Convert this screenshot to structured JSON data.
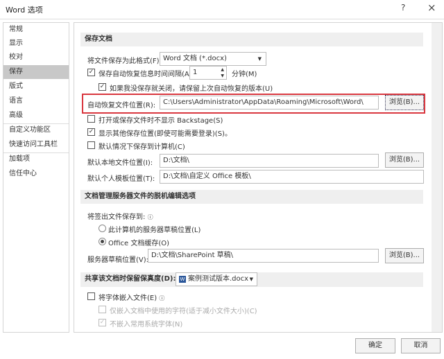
{
  "window": {
    "title": "Word 选项",
    "help": "?",
    "close": "×"
  },
  "sidebar": {
    "items": [
      "常规",
      "显示",
      "校对",
      "保存",
      "版式",
      "语言",
      "高级",
      "自定义功能区",
      "快速访问工具栏",
      "加载项",
      "信任中心"
    ],
    "selected": "保存"
  },
  "save": {
    "section_title": "保存文档",
    "format_label": "将文件保存为此格式(F):",
    "format_value": "Word 文档 (*.docx)",
    "autosave_label": "保存自动恢复信息时间间隔(A)",
    "autosave_checked": true,
    "autosave_value": "1",
    "minutes_label": "分钟(M)",
    "keep_last_label": "如果我没保存就关闭，请保留上次自动恢复的版本(U)",
    "keep_last_checked": true,
    "autorecover_label": "自动恢复文件位置(R):",
    "autorecover_value": "C:\\Users\\Administrator\\AppData\\Roaming\\Microsoft\\Word\\",
    "browse": "浏览(B)...",
    "no_backstage_label": "打开或保存文件时不显示 Backstage(S)",
    "no_backstage_checked": false,
    "show_other_label": "显示其他保存位置(即使可能需要登录)(S)。",
    "show_other_checked": true,
    "save_computer_label": "默认情况下保存到计算机(C)",
    "save_computer_checked": false,
    "local_label": "默认本地文件位置(I):",
    "local_value": "D:\\文档\\",
    "template_label": "默认个人模板位置(T):",
    "template_value": "D:\\文档\\自定义 Office 模板\\"
  },
  "offline": {
    "section_title": "文档管理服务器文件的脱机编辑选项",
    "checkout_label": "将签出文件保存到:",
    "radio1": "此计算机的服务器草稿位置(L)",
    "radio2": "Office 文档缓存(O)",
    "selected": "Office 文档缓存(O)",
    "drafts_label": "服务器草稿位置(V):",
    "drafts_value": "D:\\文档\\SharePoint 草稿\\"
  },
  "fidelity": {
    "section_title": "共享该文档时保留保真度(D):",
    "doc_value": "案例测试版本.docx",
    "embed_label": "将字体嵌入文件(E)",
    "embed_checked": false,
    "only_used_label": "仅嵌入文档中使用的字符(适于减小文件大小)(C)",
    "only_used_checked": false,
    "no_common_label": "不嵌入常用系统字体(N)",
    "no_common_checked": true
  },
  "footer": {
    "ok": "确定",
    "cancel": "取消"
  },
  "colors": {
    "highlight": "#d9363e",
    "selected_bg": "#c8c8c8"
  }
}
